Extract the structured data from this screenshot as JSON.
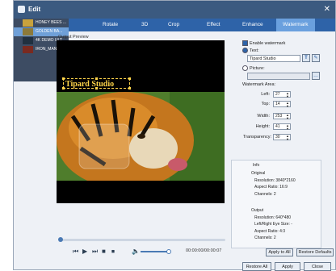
{
  "window": {
    "title": "Edit",
    "close_glyph": "✕"
  },
  "files": [
    {
      "name": "HONEY BEES ...",
      "thumb_color": "#c9a23c"
    },
    {
      "name": "GOLDEN BA...",
      "thumb_color": "#8c7a3a"
    },
    {
      "name": "4K DEMO ULT...",
      "thumb_color": "#203040"
    },
    {
      "name": "IRON_MAN_3...",
      "thumb_color": "#7a2a20"
    }
  ],
  "tabs": [
    "Rotate",
    "3D",
    "Crop",
    "Effect",
    "Enhance",
    "Watermark"
  ],
  "preview": {
    "label": "Output Preview",
    "watermark_text": "Tipard Studio",
    "time": "00:00:00/00:00:07"
  },
  "watermark": {
    "enable_label": "Enable watermark",
    "text_label": "Text:",
    "text_value": "Tipard Studio",
    "picture_label": "Picture:",
    "area_label": "Watermark Area:",
    "left_label": "Left:",
    "left_value": "27",
    "top_label": "Top:",
    "top_value": "14",
    "width_label": "Width:",
    "width_value": "253",
    "height_label": "Height:",
    "height_value": "41",
    "transparency_label": "Transparency:",
    "transparency_value": "30"
  },
  "info": {
    "header": "Info",
    "original_label": "Original",
    "orig_resolution": "Resolution: 3840*2160",
    "orig_aspect": "Aspect Ratio: 16:9",
    "orig_channels": "Channels: 2",
    "output_label": "Output",
    "out_resolution": "Resolution: 640*480",
    "out_eye": "Left/Right Eye Size: -",
    "out_aspect": "Aspect Ratio: 4:3",
    "out_channels": "Channels: 2"
  },
  "buttons": {
    "apply_to_all": "Apply to All",
    "restore_defaults": "Restore Defaults",
    "restore_all": "Restore All",
    "apply": "Apply",
    "close": "Close"
  },
  "colors": {
    "title_bar": "#3b5a80",
    "tab_bar": "#2e63a8",
    "active_tab": "#6aa0de",
    "watermark": "#ffd54a"
  }
}
